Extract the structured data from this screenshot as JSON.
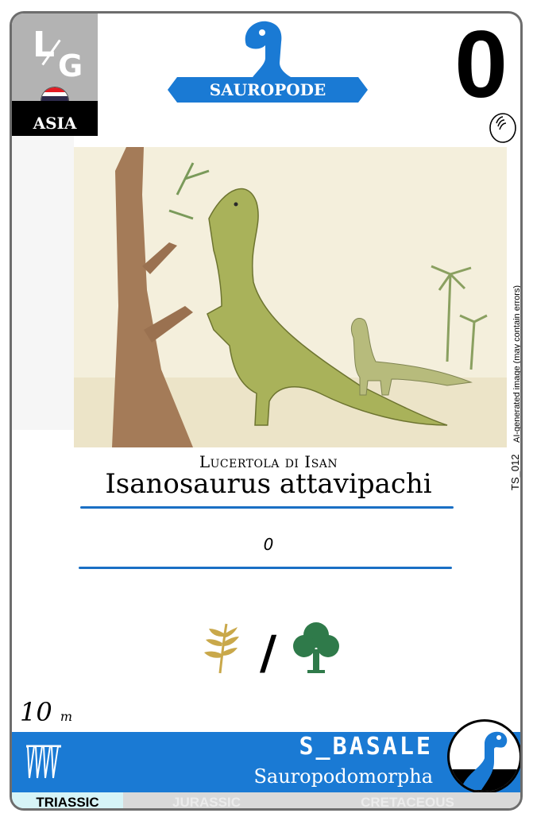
{
  "header": {
    "logo_left": "L",
    "logo_right": "G",
    "region": "ASIA",
    "flag": "thailand-flag-icon",
    "type_label": "SAUROPODE",
    "score": "0",
    "egg_icon": "egg-icon"
  },
  "illustration": {
    "ai_note": "AI-generated image (may contain errors)",
    "code": "TS_012"
  },
  "names": {
    "common": "Lucertola di Isan",
    "scientific": "Isanosaurus attavipachi",
    "description": "0"
  },
  "diet": {
    "separator": "/",
    "icons": [
      "fern-icon",
      "tree-icon"
    ]
  },
  "size": {
    "value": "10",
    "unit": "m"
  },
  "classification": {
    "group": "S_BASALE",
    "clade": "Sauropodomorpha"
  },
  "eras": [
    {
      "label": "TRIASSIC",
      "active": true
    },
    {
      "label": "JURASSIC",
      "active": false
    },
    {
      "label": "CRETACEOUS",
      "active": false
    }
  ],
  "colors": {
    "accent": "#1a7ad4",
    "logo_bg": "#b3b3b3",
    "active_era": "#d6f4f7",
    "fern": "#c9a84a",
    "tree": "#2f7a4a"
  }
}
